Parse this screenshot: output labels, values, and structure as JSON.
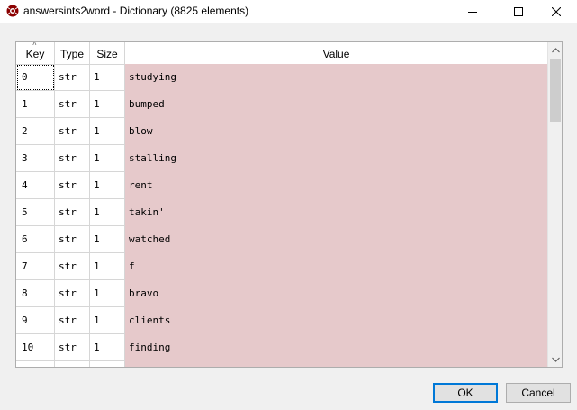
{
  "window": {
    "title": "answersints2word - Dictionary (8825 elements)",
    "app_icon": "spyder-icon"
  },
  "table": {
    "columns": [
      "Key",
      "Type",
      "Size",
      "Value"
    ],
    "rows": [
      {
        "key": "0",
        "type": "str",
        "size": "1",
        "value": "studying"
      },
      {
        "key": "1",
        "type": "str",
        "size": "1",
        "value": "bumped"
      },
      {
        "key": "2",
        "type": "str",
        "size": "1",
        "value": "blow"
      },
      {
        "key": "3",
        "type": "str",
        "size": "1",
        "value": "stalling"
      },
      {
        "key": "4",
        "type": "str",
        "size": "1",
        "value": "rent"
      },
      {
        "key": "5",
        "type": "str",
        "size": "1",
        "value": "takin'"
      },
      {
        "key": "6",
        "type": "str",
        "size": "1",
        "value": "watched"
      },
      {
        "key": "7",
        "type": "str",
        "size": "1",
        "value": "f"
      },
      {
        "key": "8",
        "type": "str",
        "size": "1",
        "value": "bravo"
      },
      {
        "key": "9",
        "type": "str",
        "size": "1",
        "value": "clients"
      },
      {
        "key": "10",
        "type": "str",
        "size": "1",
        "value": "finding"
      },
      {
        "key": "",
        "type": "",
        "size": "",
        "value": ""
      }
    ],
    "value_cell_color": "#e6c9cb"
  },
  "buttons": {
    "ok": "OK",
    "cancel": "Cancel"
  }
}
